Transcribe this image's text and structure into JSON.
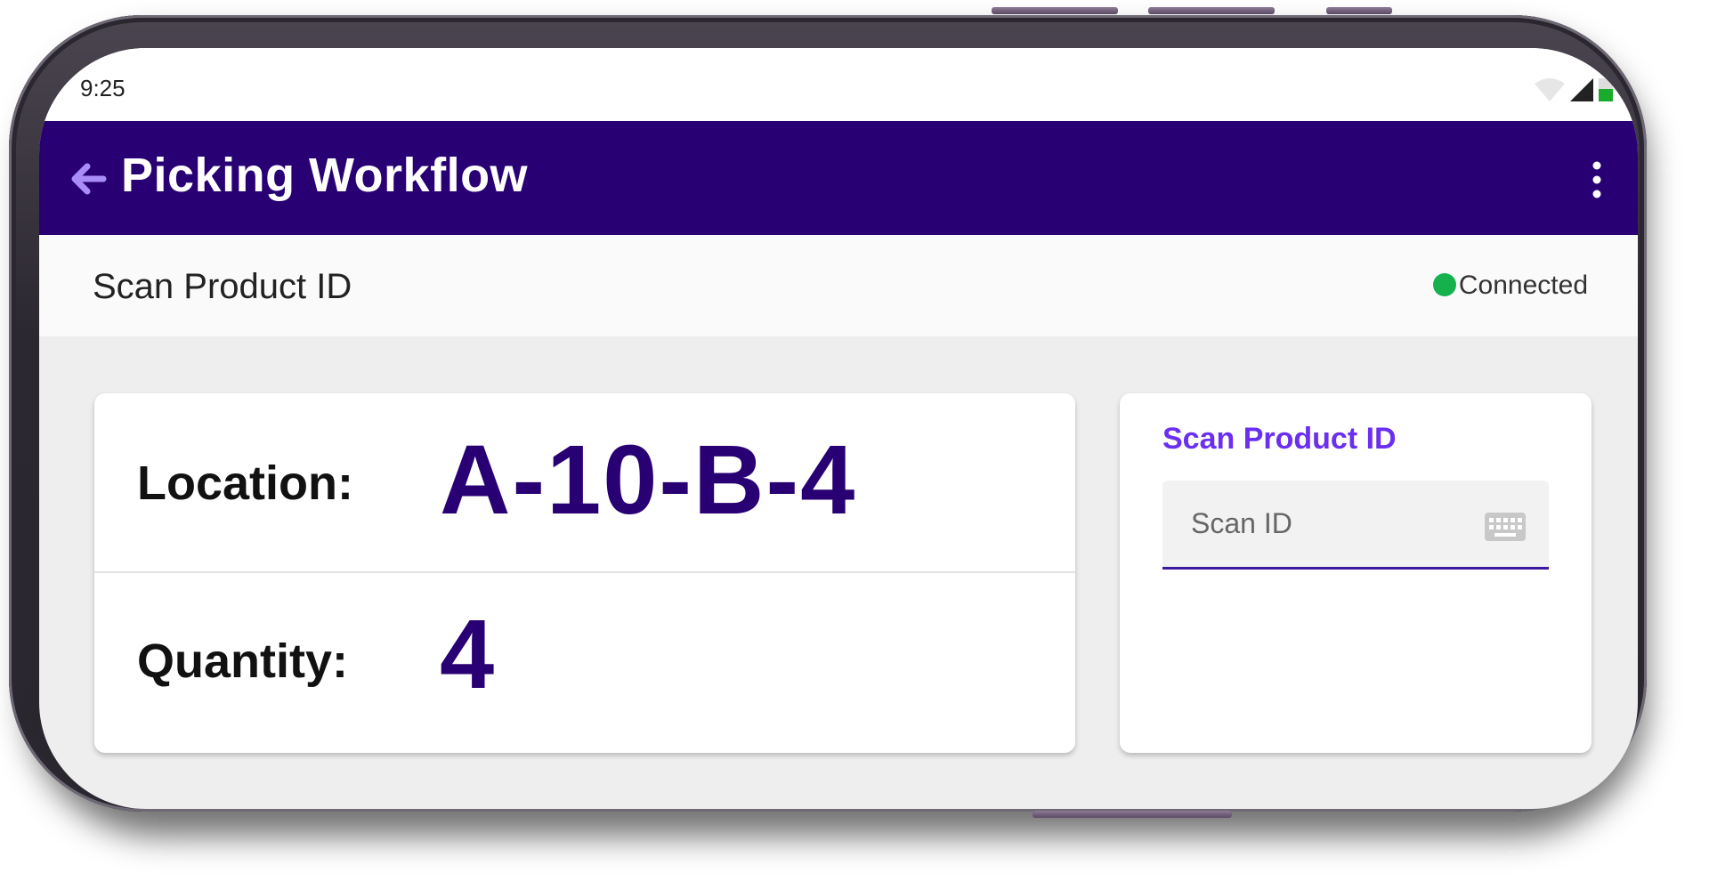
{
  "status_bar": {
    "time": "9:25"
  },
  "app_bar": {
    "title": "Picking Workflow",
    "icons": [
      "back-arrow-icon",
      "more-vert-icon"
    ],
    "background_color": "#280074"
  },
  "sub_header": {
    "title": "Scan Product ID",
    "connection_status": "Connected",
    "connection_color": "#14b14c"
  },
  "pick_card": {
    "location_label": "Location:",
    "location_value": "A-10-B-4",
    "quantity_label": "Quantity:",
    "quantity_value": "4",
    "value_color": "#280074"
  },
  "scan_card": {
    "label": "Scan Product ID",
    "input_placeholder": "Scan ID",
    "input_value": "",
    "icon": "keyboard-icon",
    "accent_color": "#6a2ff0"
  }
}
